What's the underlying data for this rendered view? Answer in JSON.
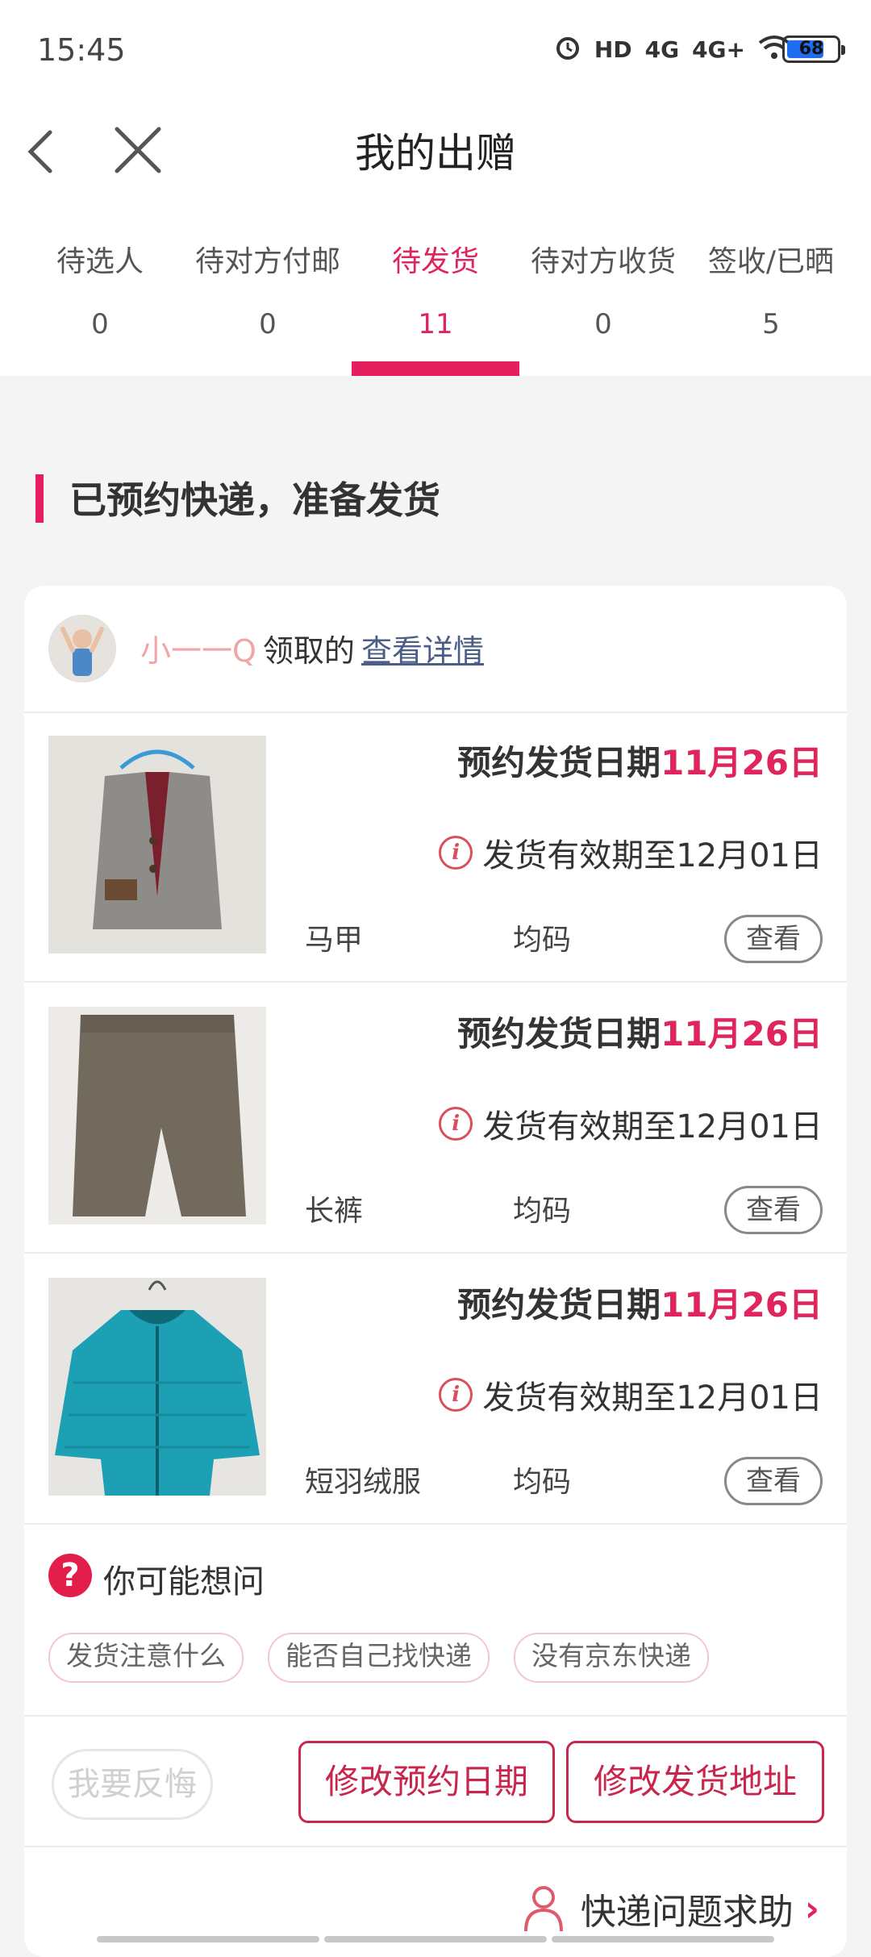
{
  "status_bar": {
    "time": "15:45",
    "hd": "HD",
    "net1": "4G",
    "net2": "4G+",
    "battery": "68"
  },
  "header": {
    "title": "我的出赠"
  },
  "tabs": [
    {
      "label": "待选人",
      "count": "0"
    },
    {
      "label": "待对方付邮",
      "count": "0"
    },
    {
      "label": "待发货",
      "count": "11",
      "active": true
    },
    {
      "label": "待对方收货",
      "count": "0"
    },
    {
      "label": "签收/已晒",
      "count": "5"
    }
  ],
  "section_title": "已预约快递，准备发货",
  "receiver": {
    "name": "小一一Q",
    "text": "领取的",
    "link": "查看详情"
  },
  "items": [
    {
      "ship_label": "预约发货日期",
      "ship_date": "11月26日",
      "valid": "发货有效期至12月01日",
      "name": "马甲",
      "size": "均码",
      "view": "查看"
    },
    {
      "ship_label": "预约发货日期",
      "ship_date": "11月26日",
      "valid": "发货有效期至12月01日",
      "name": "长裤",
      "size": "均码",
      "view": "查看"
    },
    {
      "ship_label": "预约发货日期",
      "ship_date": "11月26日",
      "valid": "发货有效期至12月01日",
      "name": "短羽绒服",
      "size": "均码",
      "view": "查看"
    }
  ],
  "faq": {
    "title": "你可能想问",
    "chips": [
      "发货注意什么",
      "能否自己找快递",
      "没有京东快递"
    ]
  },
  "actions": {
    "regret": "我要反悔",
    "change_date": "修改预约日期",
    "change_address": "修改发货地址"
  },
  "help": {
    "label": "快递问题求助"
  },
  "colors": {
    "accent": "#e41e5f",
    "button_red": "#c8264c"
  }
}
